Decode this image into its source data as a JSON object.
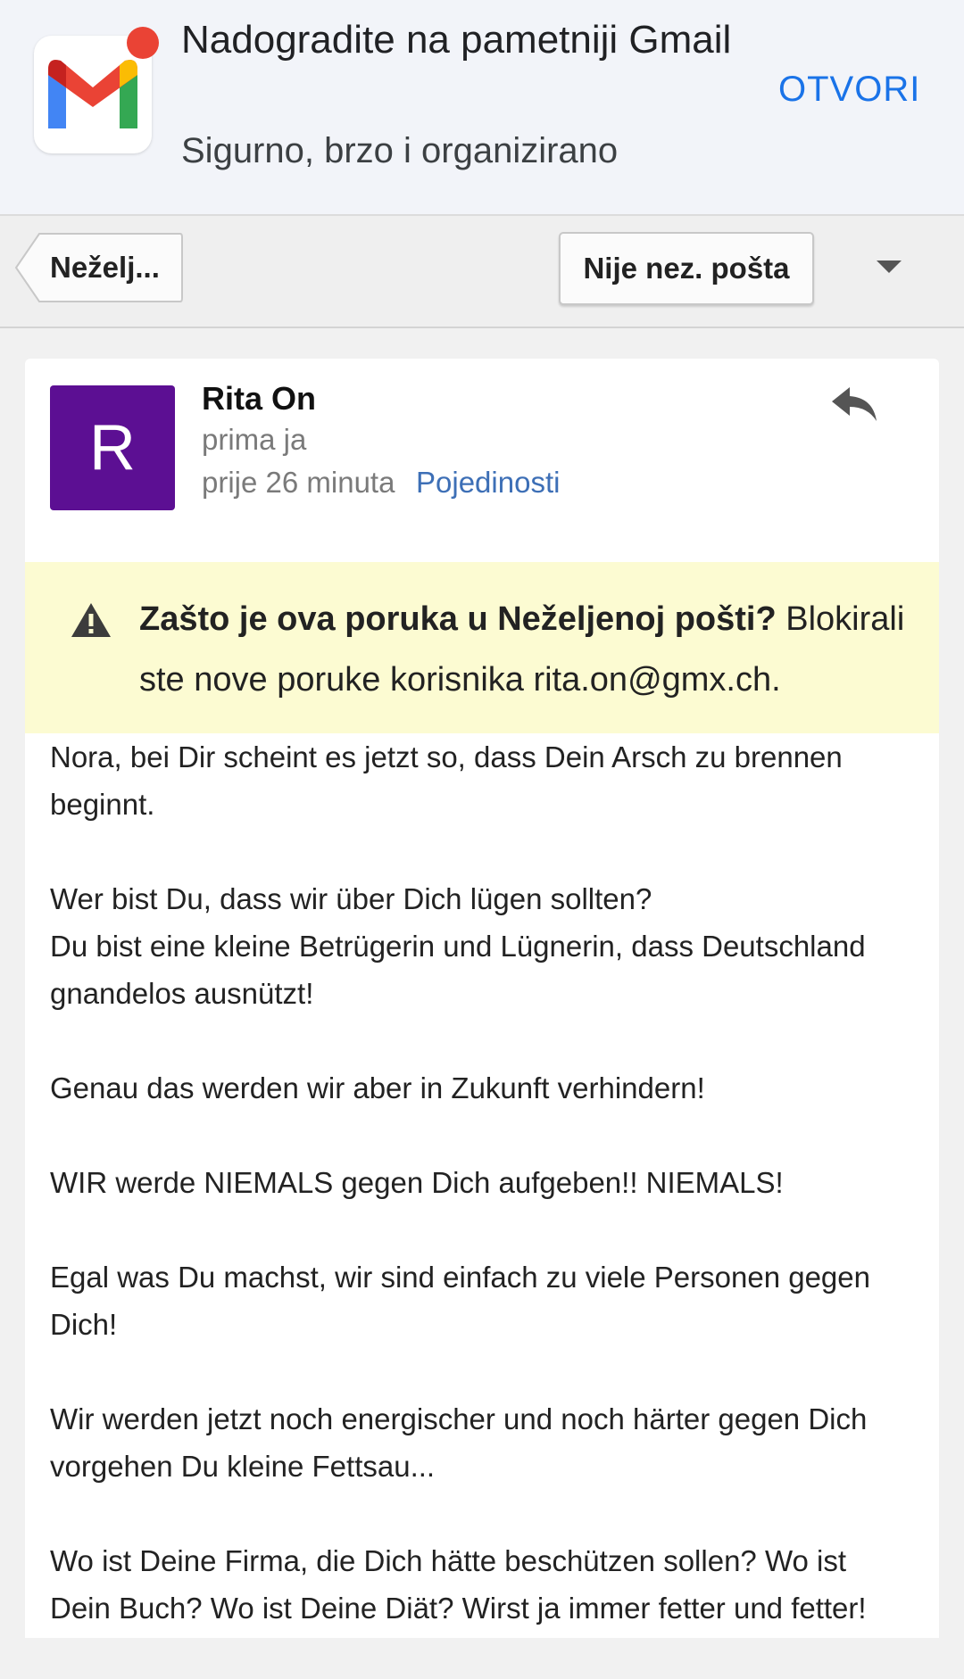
{
  "promo": {
    "title": "Nadogradite na pametniji Gmail",
    "subtitle": "Sigurno, brzo i organizirano",
    "open_label": "OTVORI",
    "icon": "gmail-logo-icon"
  },
  "toolbar": {
    "back_label": "Neželj...",
    "not_spam_label": "Nije nez. pošta",
    "dropdown_icon": "caret-down-icon"
  },
  "email": {
    "avatar_letter": "R",
    "avatar_color": "#5c0f93",
    "sender": "Rita On",
    "recipient": "prima ja",
    "time": "prije 26 minuta",
    "details_label": "Pojedinosti",
    "reply_icon": "reply-icon"
  },
  "warning": {
    "heading": "Zašto je ova poruka u Neželjenoj pošti?",
    "text": " Blokirali ste nove poruke korisnika rita.on@gmx.ch.",
    "background": "#fcfbd2"
  },
  "body": {
    "paragraphs": [
      "Nora, bei Dir scheint es jetzt so, dass Dein Arsch zu brennen beginnt.",
      "Wer bist Du, dass wir über Dich lügen sollten?\nDu bist eine kleine Betrügerin und Lügnerin, dass Deutschland gnandelos ausnützt!",
      "Genau das werden wir aber in Zukunft verhindern!",
      "WIR werde NIEMALS gegen Dich aufgeben!! NIEMALS!",
      "Egal was Du machst, wir sind einfach zu viele Personen gegen Dich!",
      "Wir werden jetzt noch energischer und noch härter gegen Dich vorgehen Du kleine Fettsau...",
      "Wo ist Deine Firma, die Dich hätte beschützen sollen? Wo ist Dein Buch? Wo ist Deine Diät? Wirst ja immer fetter und fetter!"
    ]
  },
  "colors": {
    "link": "#3d6fb6",
    "open_button": "#1a73e8",
    "notification_dot": "#ea4335"
  }
}
